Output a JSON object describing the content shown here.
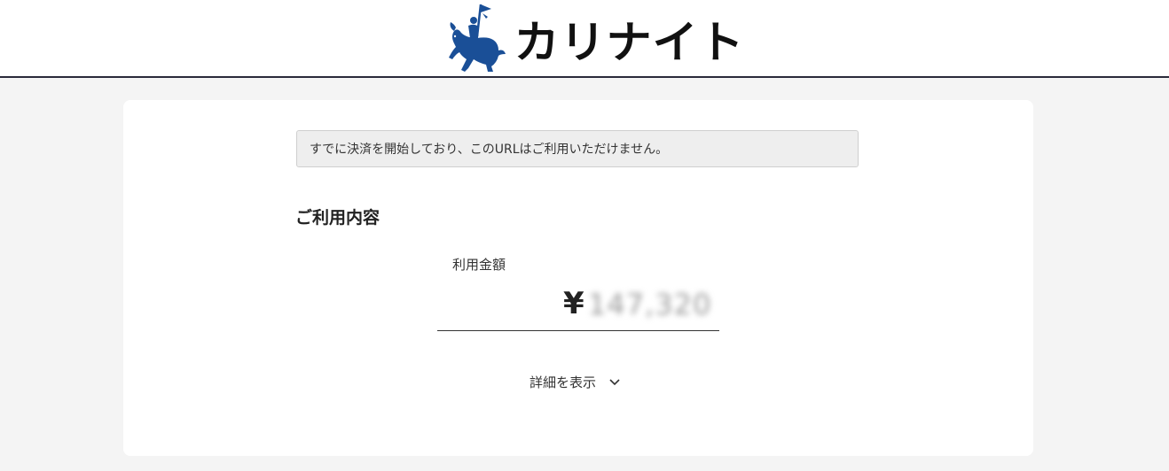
{
  "header": {
    "brand_name": "カリナイト",
    "logo_icon": "knight-on-horse-icon"
  },
  "notice": {
    "text": "すでに決済を開始しており、このURLはご利用いただけません。"
  },
  "usage": {
    "section_title": "ご利用内容",
    "amount_label": "利用金額",
    "currency_symbol": "¥",
    "amount_value": "147,320"
  },
  "details": {
    "toggle_label": "詳細を表示",
    "toggle_icon": "chevron-down-icon"
  },
  "colors": {
    "brand_blue": "#1a4f97",
    "page_background": "#f4f4f4",
    "card_background": "#ffffff",
    "header_rule": "#2a2a3a"
  }
}
